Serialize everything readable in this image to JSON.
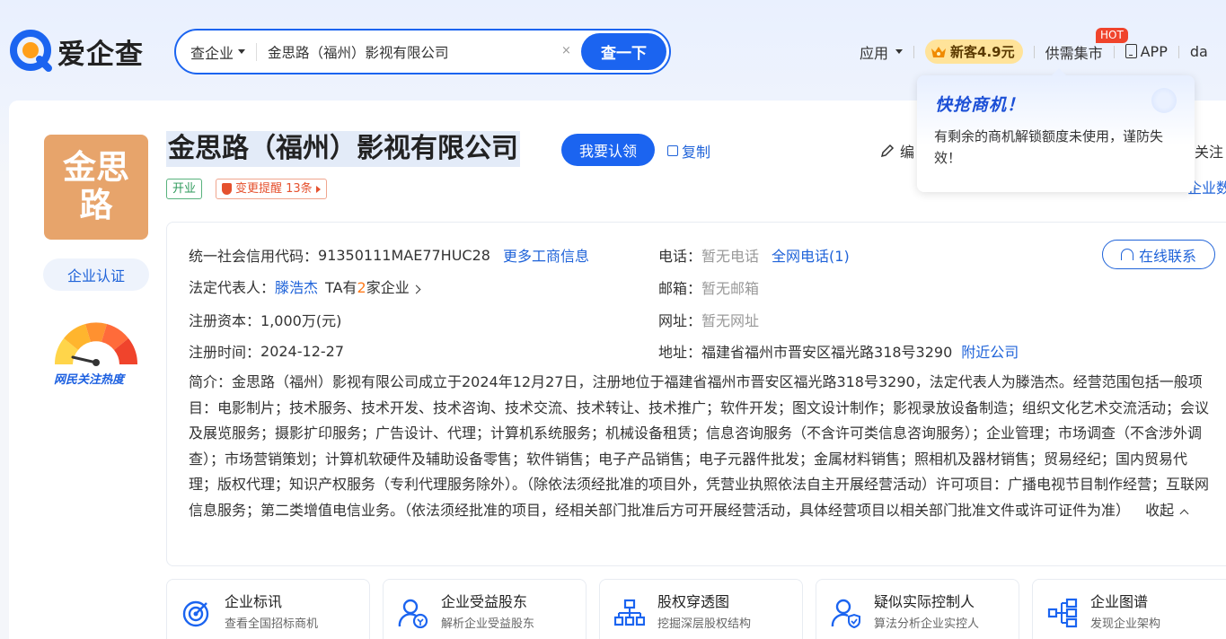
{
  "brand": {
    "name": "爱企查"
  },
  "search": {
    "type_label": "查企业",
    "value": "金思路（福州）影视有限公司",
    "button": "查一下"
  },
  "nav": {
    "apps": "应用",
    "vip": "新客4.9元",
    "market": "供需集市",
    "hot": "HOT",
    "app": "APP",
    "user": "da"
  },
  "popup": {
    "title": "快抢商机！",
    "text": "有剩余的商机解锁额度未使用，谨防失效！"
  },
  "company": {
    "avatar_text": "金思路",
    "name": "金思路（福州）影视有限公司",
    "claim": "我要认领",
    "copy": "复制",
    "status": "开业",
    "change_alert": "变更提醒 13条",
    "edit": "编",
    "follow": "关注",
    "data_link": "企业数据",
    "cert": "企业认证",
    "heat_label": "网民关注热度"
  },
  "info": {
    "credit_label": "统一社会信用代码：",
    "credit_value": "91350111MAE77HUC28",
    "more_info": "更多工商信息",
    "legal_label": "法定代表人：",
    "legal_value": "滕浩杰",
    "legal_ta_pre": "TA有",
    "legal_ta_num": "2",
    "legal_ta_post": "家企业",
    "capital_label": "注册资本：",
    "capital_value": "1,000万(元)",
    "reg_label": "注册时间：",
    "reg_value": "2024-12-27",
    "phone_label": "电话：",
    "phone_value": "暂无电话",
    "phone_link": "全网电话(1)",
    "email_label": "邮箱：",
    "email_value": "暂无邮箱",
    "web_label": "网址：",
    "web_value": "暂无网址",
    "addr_label": "地址：",
    "addr_value": "福建省福州市晋安区福光路318号3290",
    "addr_link": "附近公司",
    "online": "在线联系",
    "intro": "简介：金思路（福州）影视有限公司成立于2024年12月27日，注册地位于福建省福州市晋安区福光路318号3290，法定代表人为滕浩杰。经营范围包括一般项目：电影制片；技术服务、技术开发、技术咨询、技术交流、技术转让、技术推广；软件开发；图文设计制作；影视录放设备制造；组织文化艺术交流活动；会议及展览服务；摄影扩印服务；广告设计、代理；计算机系统服务；机械设备租赁；信息咨询服务（不含许可类信息咨询服务）；企业管理；市场调查（不含涉外调查）；市场营销策划；计算机软硬件及辅助设备零售；软件销售；电子产品销售；电子元器件批发；金属材料销售；照相机及器材销售；贸易经纪；国内贸易代理；版权代理；知识产权服务（专利代理服务除外）。（除依法须经批准的项目外，凭营业执照依法自主开展经营活动）许可项目：广播电视节目制作经营；互联网信息服务；第二类增值电信业务。（依法须经批准的项目，经相关部门批准后方可开展经营活动，具体经营项目以相关部门批准文件或许可证件为准）",
    "collapse": "收起"
  },
  "features": [
    {
      "title": "企业标讯",
      "sub": "查看全国招标商机"
    },
    {
      "title": "企业受益股东",
      "sub": "解析企业受益股东"
    },
    {
      "title": "股权穿透图",
      "sub": "挖掘深层股权结构"
    },
    {
      "title": "疑似实际控制人",
      "sub": "算法分析企业实控人"
    },
    {
      "title": "企业图谱",
      "sub": "发现企业架构"
    }
  ],
  "colors": {
    "primary": "#1b64f0",
    "avatar": "#e7a46b",
    "vip": "#ffe39a",
    "hot": "#f0442c"
  }
}
